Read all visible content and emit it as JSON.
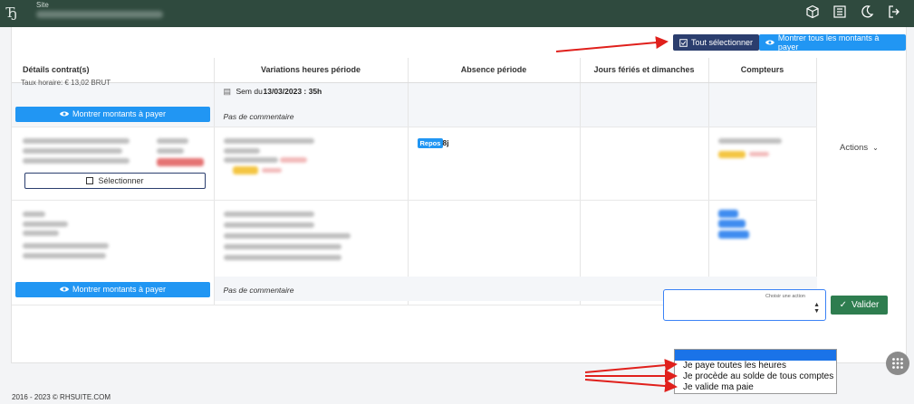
{
  "header": {
    "logo": "Ђ",
    "site_label": "Site",
    "icons": [
      "cube-icon",
      "list-icon",
      "moon-icon",
      "logout-icon"
    ]
  },
  "toolbar": {
    "select_all": "Tout sélectionner",
    "show_all_amounts": "Montrer tous les montants à payer"
  },
  "table": {
    "columns": [
      "Détails contrat(s)",
      "Variations heures période",
      "Absence période",
      "Jours fériés et dimanches",
      "Compteurs"
    ],
    "row0": {
      "partial_text": "Taux horaire: € 13,02 BRUT",
      "week_prefix": "Sem du ",
      "week_value": "13/03/2023 : 35h",
      "show_amounts": "Montrer montants à payer",
      "comment": "Pas de commentaire"
    },
    "row1": {
      "absence_badge": "Repos",
      "absence_days": "8j",
      "select_button": "Sélectionner",
      "actions": "Actions"
    },
    "row2": {
      "show_amounts": "Montrer montants à payer",
      "comment": "Pas de commentaire"
    }
  },
  "action_select": {
    "label": "Choisir une action",
    "options": [
      "",
      "Je paye toutes les heures",
      "Je procède au solde de tous comptes",
      "Je valide ma paie"
    ]
  },
  "validate_button": "Valider",
  "footer": "2016 - 2023 © RHSUITE.COM",
  "colors": {
    "topbar": "#2f4a3e",
    "primary_dark": "#2b3e6e",
    "info": "#2196f3",
    "success": "#2e7d4f",
    "annotation_arrow": "#e0201c"
  }
}
